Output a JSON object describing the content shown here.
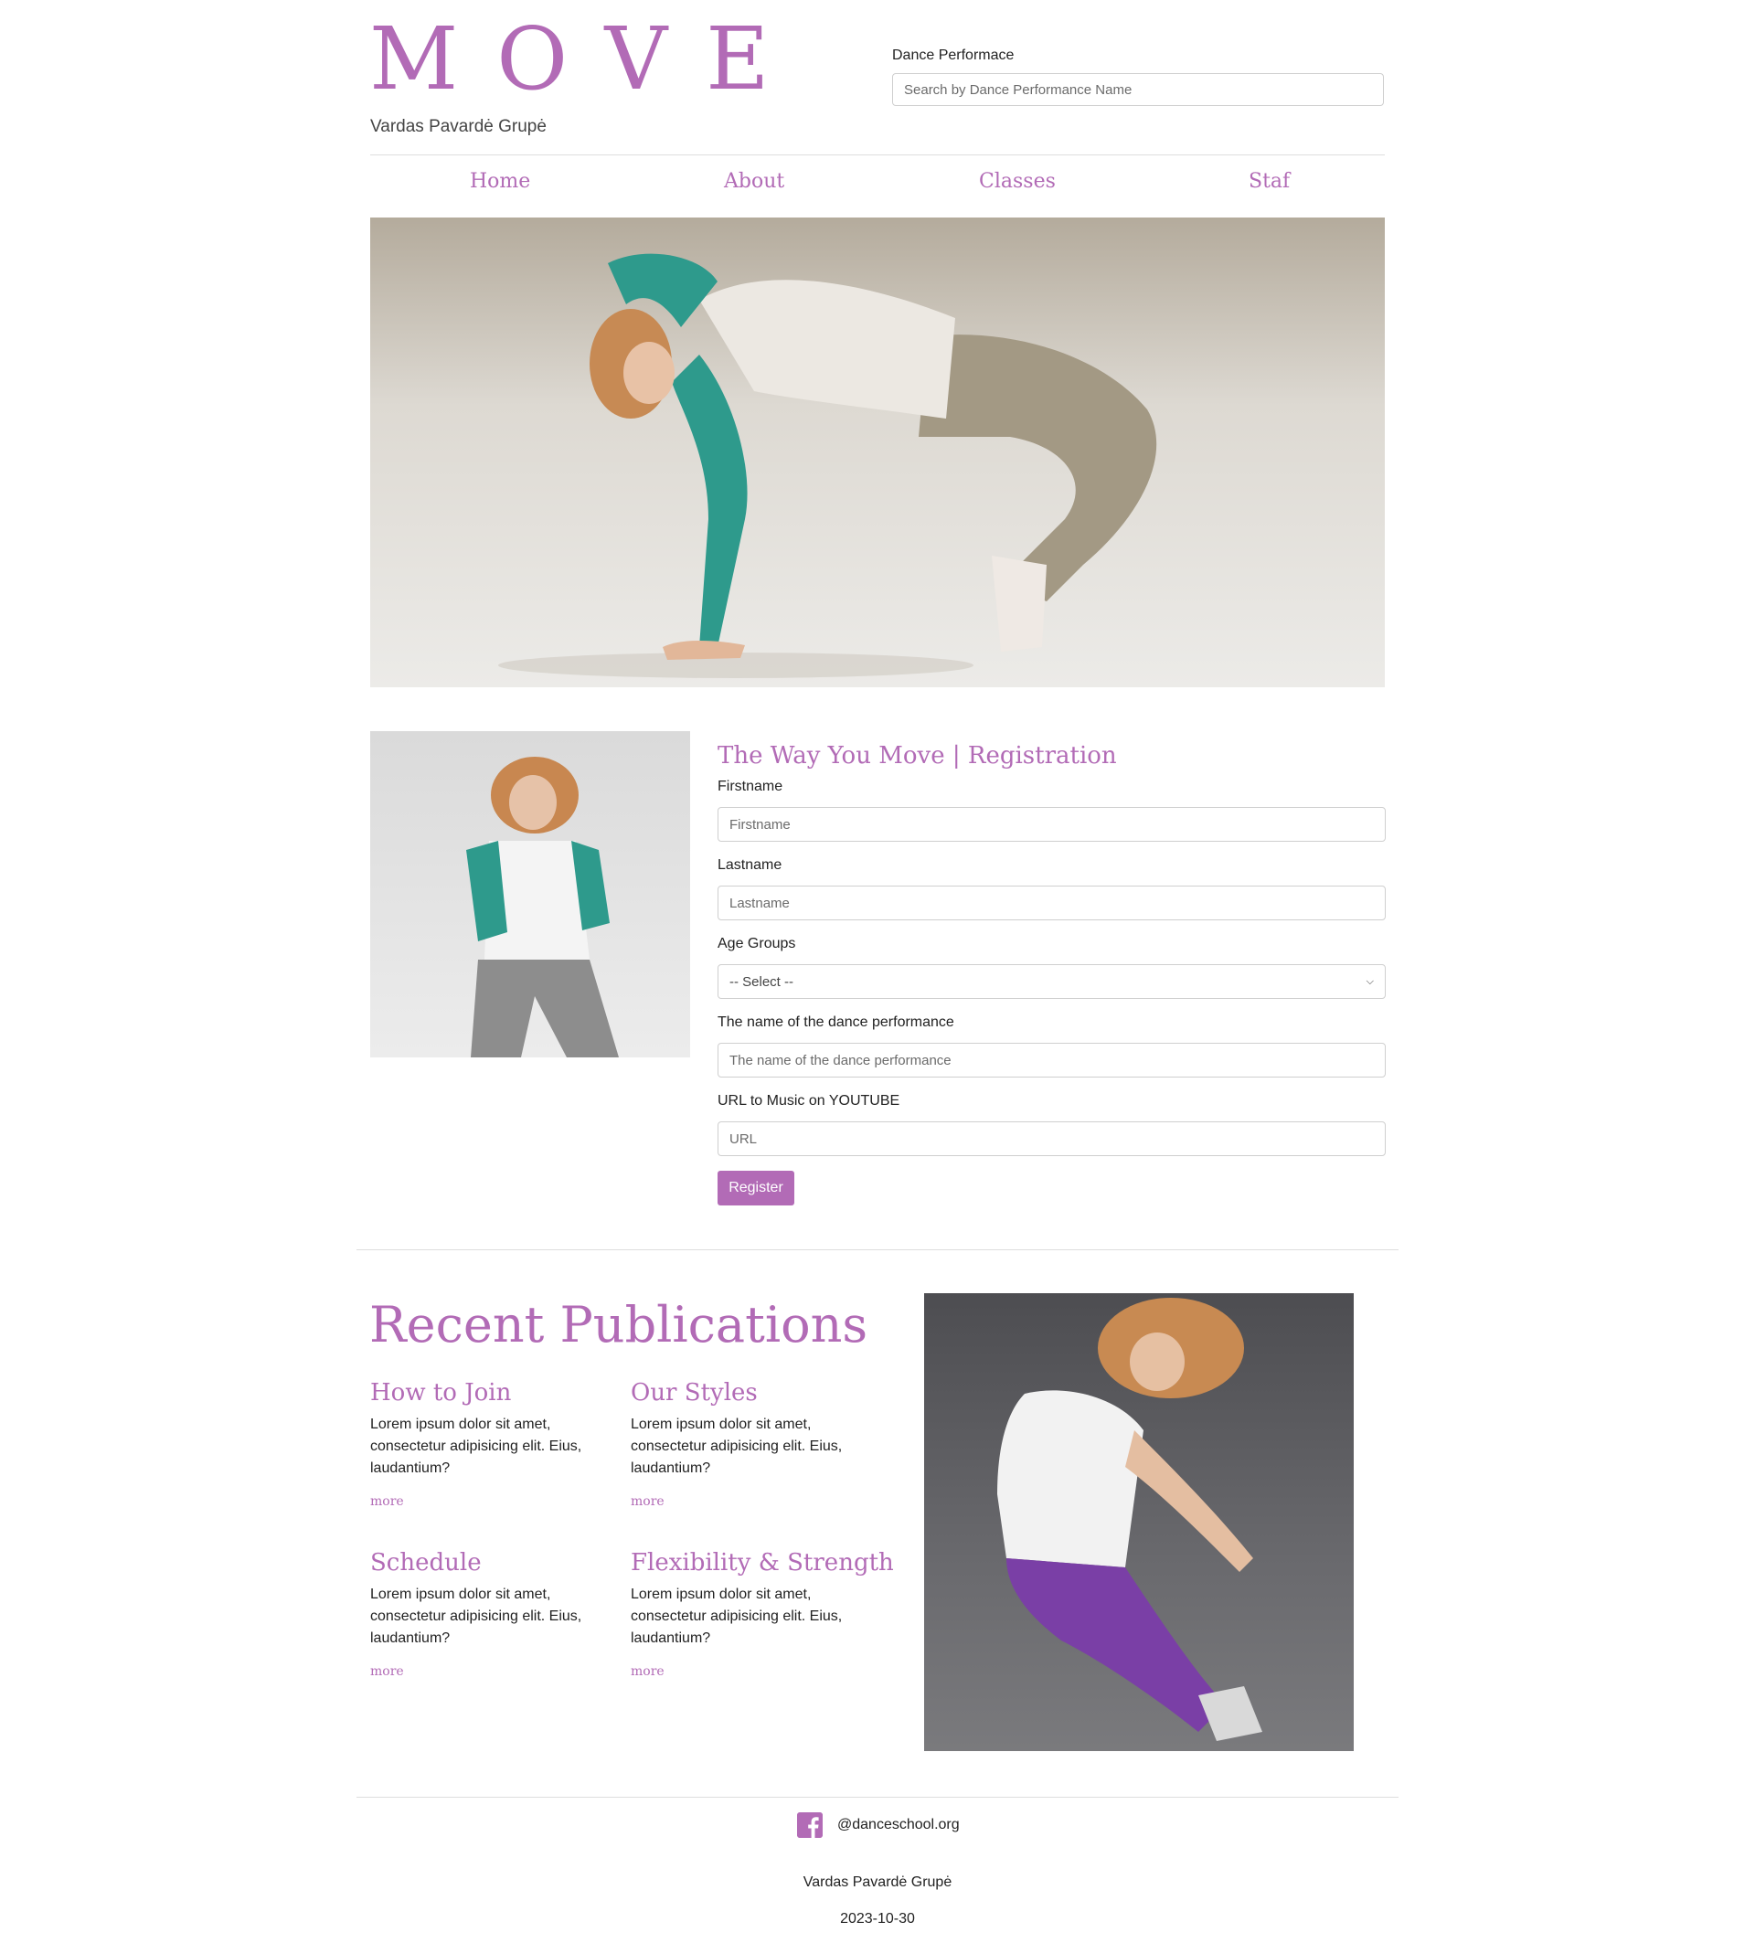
{
  "header": {
    "logo": "MOVE",
    "subtitle": "Vardas Pavardė Grupė",
    "search_label": "Dance Performace",
    "search_placeholder": "Search by Dance Performance Name"
  },
  "nav": {
    "items": [
      {
        "label": "Home"
      },
      {
        "label": "About"
      },
      {
        "label": "Classes"
      },
      {
        "label": "Staf"
      }
    ]
  },
  "registration": {
    "title": "The Way You Move | Registration",
    "firstname_label": "Firstname",
    "firstname_placeholder": "Firstname",
    "lastname_label": "Lastname",
    "lastname_placeholder": "Lastname",
    "age_label": "Age Groups",
    "age_selected": "-- Select --",
    "performance_label": "The name of the dance performance",
    "performance_placeholder": "The name of the dance performance",
    "url_label": "URL to Music on YOUTUBE",
    "url_placeholder": "URL",
    "submit_label": "Register"
  },
  "publications": {
    "heading": "Recent Publications",
    "cards": [
      {
        "title": "How to Join",
        "text": "Lorem ipsum dolor sit amet, consectetur adipisicing elit. Eius, laudantium?",
        "more": "more"
      },
      {
        "title": "Our Styles",
        "text": "Lorem ipsum dolor sit amet, consectetur adipisicing elit. Eius, laudantium?",
        "more": "more"
      },
      {
        "title": "Schedule",
        "text": "Lorem ipsum dolor sit amet, consectetur adipisicing elit. Eius, laudantium?",
        "more": "more"
      },
      {
        "title": "Flexibility & Strength",
        "text": "Lorem ipsum dolor sit amet, consectetur adipisicing elit. Eius, laudantium?",
        "more": "more"
      }
    ]
  },
  "footer": {
    "facebook_icon": "facebook-icon",
    "facebook_handle": "@danceschool.org",
    "author": "Vardas Pavardė Grupė",
    "date": "2023-10-30"
  },
  "colors": {
    "accent": "#b26bb6"
  }
}
